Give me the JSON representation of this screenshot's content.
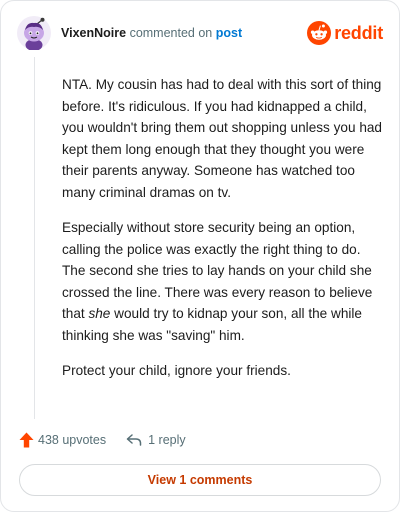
{
  "header": {
    "username": "VixenNoire",
    "action_text": "commented on",
    "post_link": "post",
    "brand": "reddit"
  },
  "comment": {
    "paragraph1": "NTA. My cousin has had to deal with this sort of thing before. It's ridiculous. If you had kidnapped a child, you wouldn't bring them out shopping unless you had kept them long enough that they thought you were their parents anyway. Someone has watched too many criminal dramas on tv.",
    "paragraph2_before": "Especially without store security being an option, calling the police was exactly the right thing to do. The second she tries to lay hands on your child she crossed the line. There was every reason to believe that ",
    "paragraph2_emphasis": "she",
    "paragraph2_after": " would try to kidnap your son, all the while thinking she was \"saving\" him.",
    "paragraph3": "Protect your child, ignore your friends."
  },
  "actions": {
    "upvotes": "438 upvotes",
    "replies": "1 reply"
  },
  "view_comments_label": "View 1 comments",
  "colors": {
    "brand": "#ff4500",
    "link": "#0079d3",
    "upvote": "#ff4500",
    "view_button_text": "#c53a00"
  },
  "icons": {
    "avatar": "snoo-avatar-purple",
    "brand": "reddit-snoo-icon",
    "upvote": "upvote-arrow-icon",
    "reply": "reply-arrow-icon"
  }
}
